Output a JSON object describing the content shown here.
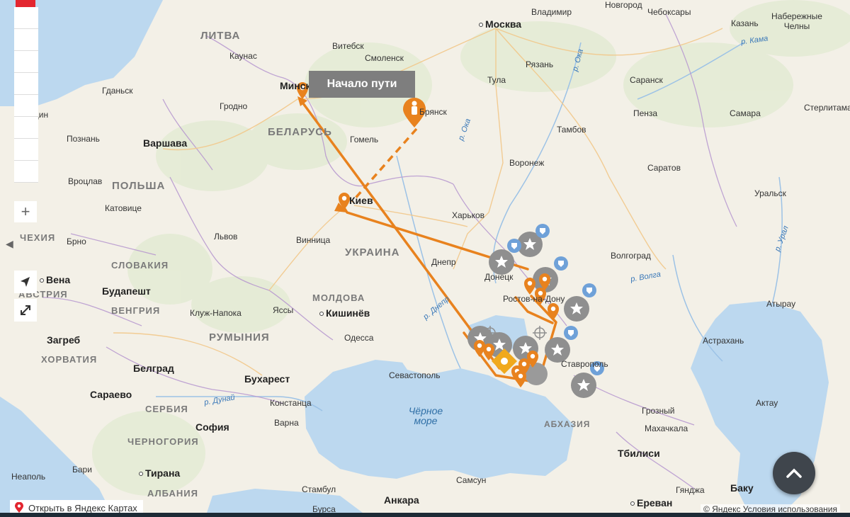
{
  "route_label": "Начало пути",
  "open_link": "Открыть в Яндекс Картах",
  "copyright": "© Яндекс Условия использования",
  "countries": [
    "ЛИТВА",
    "БЕЛАРУСЬ",
    "ПОЛЬША",
    "УКРАИНА",
    "ЧЕХИЯ",
    "СЛОВАКИЯ",
    "АВСТРИЯ",
    "ВЕНГРИЯ",
    "МОЛДОВА",
    "РУМЫНИЯ",
    "ХОРВАТИЯ",
    "СЕРБИЯ",
    "ЧЕРНОГОРИЯ",
    "АЛБАНИЯ",
    "АБХАЗИЯ"
  ],
  "capitals": [
    "Москва",
    "Варшава",
    "Вена",
    "Будапешт",
    "Загреб",
    "Белград",
    "Бухарест",
    "София",
    "Сараево",
    "Тирана",
    "Кишинёв",
    "Тбилиси",
    "Ереван",
    "Баку",
    "Анкара",
    "Минск",
    "Киев"
  ],
  "cities": [
    "Новгород",
    "Владимир",
    "Чебоксары",
    "Казань",
    "Набережные Челны",
    "Витебск",
    "Смоленск",
    "Каунас",
    "Гданьск",
    "Гродно",
    "Рязань",
    "Тула",
    "Саранск",
    "Брянск",
    "Пенза",
    "Самара",
    "Стерлитамак",
    "Щецин",
    "Гомель",
    "Тамбов",
    "Познань",
    "Воронеж",
    "Саратов",
    "Вроцлав",
    "Уральск",
    "Катовице",
    "Харьков",
    "Львов",
    "Брно",
    "Винница",
    "Днепр",
    "Донецк",
    "Волгоград",
    "Ростов-на-Дону",
    "Клуж-Напока",
    "Яссы",
    "Атырау",
    "Одесса",
    "Астрахань",
    "Севастополь",
    "Ставрополь",
    "Констанца",
    "Актау",
    "Грозный",
    "Варна",
    "Махачкала",
    "Бари",
    "Неаполь",
    "Самсун",
    "Гянджа",
    "Стамбул",
    "Бурса"
  ],
  "rivers": [
    "р. Кама",
    "р. Ока",
    "р. Ока",
    "р. Волга",
    "р. Урал",
    "р. Днепр",
    "р. Дунай"
  ],
  "sea_name": "Чёрное море",
  "colors": {
    "route": "#e8821e",
    "marker_gray": "#8f8f8f",
    "marker_blue": "#6fa1d8",
    "label_bg": "#7e7e7e"
  }
}
